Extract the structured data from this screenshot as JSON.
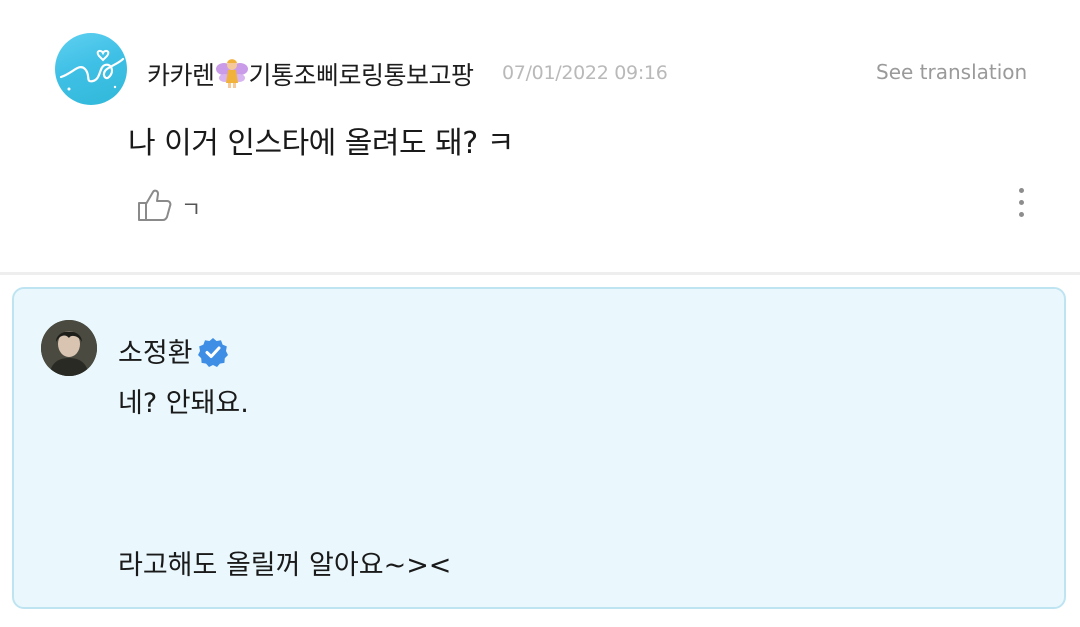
{
  "comment": {
    "username": "카카렌",
    "username_suffix": "기통조삐로링통보고팡",
    "username_emoji": "fairy-emoji",
    "timestamp": "07/01/2022 09:16",
    "see_translation_label": "See translation",
    "text": "나 이거 인스타에 올려도 돼? ㅋ",
    "like_count": "ㄱ",
    "like_icon": "thumbs-up-icon",
    "more_icon": "more-vertical-icon"
  },
  "reply": {
    "author": "소정환",
    "verified_icon": "verified-badge-icon",
    "lines": [
      "네? 안돼요.",
      "라고해도 올릴꺼 알아요~><"
    ],
    "background_color": "#eaf8fd",
    "border_color": "#bfe4f1"
  }
}
